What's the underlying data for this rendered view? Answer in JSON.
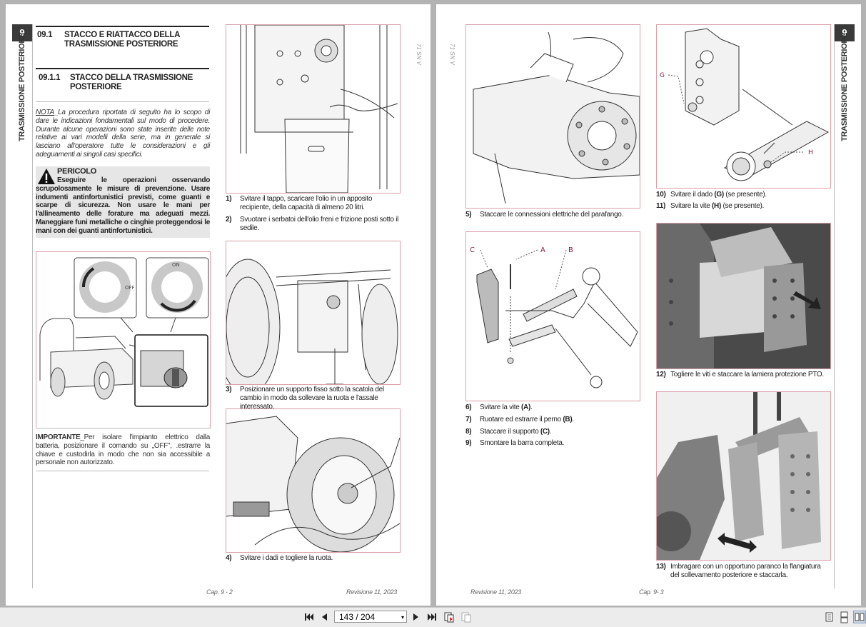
{
  "left_page": {
    "chapter_number": "9",
    "side_title": "TRASMISSIONE POSTERIORE",
    "running_header": "71 SN V",
    "section_1_number": "09.1",
    "section_1_title": "STACCO E RIATTACCO DELLA TRASMISSIONE POSTERIORE",
    "section_2_number": "09.1.1",
    "section_2_title": "STACCO DELLA TRASMISSIONE POSTERIORE",
    "nota_label": "NOTA",
    "nota_text": "_La procedura riportata di seguito ha lo scopo di dare le indicazioni fondamentali sul modo di procedere. Durante alcune operazioni sono state inserite delle note relative ai vari modelli della serie, ma in generale si lasciano all'operatore tutte le considerazioni e gli adeguamenti ai singoli casi specifici.",
    "warning_title": "PERICOLO",
    "warning_text": "Eseguire le operazioni osservando scrupolosamente le misure di prevenzione. Usare indumenti antinfortunistici previsti, come guanti e scarpe di sicurezza. Non usare le mani per l'allineamento delle forature ma adeguati mezzi. Maneggiare funi metalliche o cinghie proteggendosi le mani con dei guanti antinfortunistici.",
    "switch_off_label": "OFF",
    "switch_on_label": "ON",
    "importante_label": "IMPORTANTE",
    "importante_text": "_Per isolare l'impianto elettrico dalla batteria, posizionare il comando su „OFF\", .estrarre la chiave e custodirla in modo che non sia accessibile a personale non autorizzato.",
    "steps": [
      {
        "num": "1)",
        "text": "Svitare il tappo, scaricare l'olio in un apposito recipiente, della capacità di almeno 20 litri."
      },
      {
        "num": "2)",
        "text": "Svuotare i serbatoi dell'olio freni e frizione posti sotto il sedile."
      },
      {
        "num": "3)",
        "text": "Posizionare un supporto fisso sotto la scatola del cambio in modo da sollevare la ruota e l'assale interessato."
      },
      {
        "num": "4)",
        "text": "Svitare i dadi e togliere la ruota."
      }
    ],
    "footer_left": "Cap. 9 - 2",
    "footer_right": "Revisione 11, 2023"
  },
  "right_page": {
    "chapter_number": "9",
    "side_title": "TRASMISSIONE POSTERIORE",
    "running_header": "71 SN V",
    "step_5": {
      "num": "5)",
      "text": "Staccare le connessioni elettriche del parafango."
    },
    "labels_abc": [
      "C",
      "A",
      "B"
    ],
    "steps_6_9": [
      {
        "num": "6)",
        "text": "Svitare la vite ",
        "bold": "(A)",
        "after": "."
      },
      {
        "num": "7)",
        "text": "Ruotare ed estrarre il perno ",
        "bold": "(B)",
        "after": "."
      },
      {
        "num": "8)",
        "text": "Staccare il supporto ",
        "bold": "(C)",
        "after": "."
      },
      {
        "num": "9)",
        "text": "Smontare la barra completa.",
        "bold": "",
        "after": ""
      }
    ],
    "labels_gh": [
      "G",
      "H"
    ],
    "steps_10_11": [
      {
        "num": "10)",
        "text": "Svitare il dado ",
        "bold": "(G)",
        "after": " (se presente)."
      },
      {
        "num": "11)",
        "text": "Svitare la vite ",
        "bold": "(H)",
        "after": " (se presente)."
      }
    ],
    "step_12": {
      "num": "12)",
      "text": "Togliere le viti e staccare la lamiera protezione PTO."
    },
    "step_13": {
      "num": "13)",
      "text": "Imbragare con un opportuno paranco la flangiatura del sollevamento posteriore e staccarla."
    },
    "footer_left": "Revisione 11, 2023",
    "footer_right": "Cap. 9- 3"
  },
  "toolbar": {
    "page_indicator": "143 / 204",
    "icons": [
      "first-page-icon",
      "prev-page-icon",
      "next-page-icon",
      "last-page-icon",
      "copy-icon",
      "paste-icon",
      "single-page-view-icon",
      "continuous-view-icon",
      "two-page-view-icon"
    ]
  }
}
